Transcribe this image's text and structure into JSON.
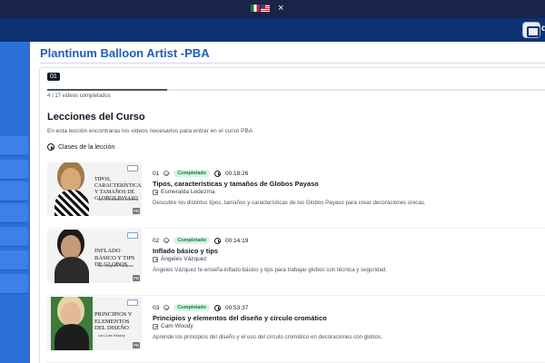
{
  "top_strip": {
    "close_symbol": "×",
    "flags": [
      "mexico-flag",
      "usa-flag"
    ]
  },
  "header": {
    "user_name_partial": "d"
  },
  "page": {
    "title": "Plantinum Balloon Artist -PBA"
  },
  "course": {
    "module_badge": "01",
    "progress_text": "4 / 17 videos completados",
    "progress_fraction": 0.235
  },
  "section": {
    "title": "Lecciones del Curso",
    "description": "En esta lección encontraras los videos necesarios para entrar en el curso PBA",
    "toggle_label": "Clases de la lección"
  },
  "lessons": [
    {
      "number": "01",
      "status": "Completado",
      "duration": "00:18:26",
      "title": "Tipos, características y tamaños de Globos Payaso",
      "author": "Esmeralda Ledezma",
      "description": "Descubre los distintos tipos, tamaños y características de los Globos Payaso para crear decoraciones únicas.",
      "thumb_title": "Tipos, características y tamaños de Globos Payaso",
      "thumb_by": "con Esmeralda Ledezma"
    },
    {
      "number": "02",
      "status": "Completado",
      "duration": "00:14:19",
      "title": "Inflado básico y tips",
      "author": "Ángeles Vázquez",
      "description": "Ángeles Vázquez te enseña inflado básico y tips para trabajar globos con técnica y seguridad.",
      "thumb_title": "Inflado básico y tips de globos",
      "thumb_by": "con Ángeles Vázquez"
    },
    {
      "number": "03",
      "status": "Completado",
      "duration": "00:53:37",
      "title": "Principios y elementos del diseño y círculo cromático",
      "author": "Cam Woody",
      "description": "Aprende los principios del diseño y el uso del círculo cromático en decoraciones con globos.",
      "thumb_title": "Principios y elementos del diseño",
      "thumb_by": "con Cam Woody"
    }
  ],
  "colors": {
    "header": "#0c3274",
    "sidebar": "#2b6fd8",
    "title": "#1f5fb8",
    "status_bg": "#d6f5e3",
    "status_text": "#0f7a43"
  }
}
